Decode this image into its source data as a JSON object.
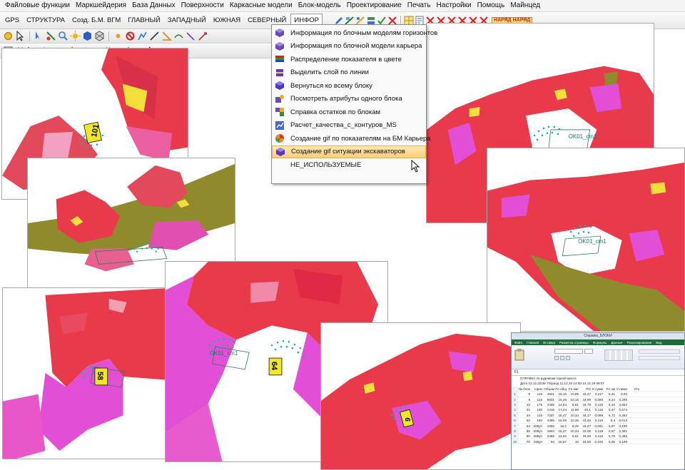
{
  "menubar": {
    "items": [
      {
        "label": "Файловые функции"
      },
      {
        "label": "Маркшейдерия"
      },
      {
        "label": "База Данных"
      },
      {
        "label": "Поверхности"
      },
      {
        "label": "Каркасные модели"
      },
      {
        "label": "Блок-модель"
      },
      {
        "label": "Проектирование"
      },
      {
        "label": "Печать"
      },
      {
        "label": "Настройки"
      },
      {
        "label": "Помощь"
      },
      {
        "label": "Майнцед"
      }
    ]
  },
  "tabs": {
    "items": [
      {
        "label": "GPS"
      },
      {
        "label": "СТРУКТУРА"
      },
      {
        "label": "Созд. Б.М. ВГМ"
      },
      {
        "label": "ГЛАВНЫЙ"
      },
      {
        "label": "ЗАПАДНЫЙ"
      },
      {
        "label": "ЮЖНАЯ"
      },
      {
        "label": "СЕВЕРНЫЙ"
      },
      {
        "label": "ИНФОР",
        "active": true
      }
    ],
    "toolbar_badge": "НАРЯД НАРЯД"
  },
  "dropdown": {
    "items": [
      {
        "label": "Информация по блочным моделям горизонтов",
        "icon": "cube-grid-icon"
      },
      {
        "label": "Информация по блочной модели карьера",
        "icon": "cube-grid-icon"
      },
      {
        "label": "Распределение показателя в цвете",
        "icon": "color-bars-icon"
      },
      {
        "label": "Выделить слой по линии",
        "icon": "layer-select-icon"
      },
      {
        "label": "Вернуться ко всему блоку",
        "icon": "cube-return-icon"
      },
      {
        "label": "Посмотреть атрибуты одного блока",
        "icon": "block-attributes-icon"
      },
      {
        "label": "Справка остатков по блокам",
        "icon": "blocks-report-icon"
      },
      {
        "label": "Расчет_качества_с_контуров_MS",
        "icon": "quality-calc-icon"
      },
      {
        "label": "Создание gif по показателям на БМ Карьера",
        "icon": "gif-indicator-icon"
      },
      {
        "label": "Создание gif ситуации  экскаваторов",
        "icon": "gif-excavator-icon",
        "highlighted": true
      },
      {
        "label": "НЕ_ИСПОЛЬЗУЕМЫЕ",
        "icon": ""
      }
    ]
  },
  "viewports": {
    "v1": {
      "marker": "101"
    },
    "v6": {
      "label": "OK01_cm1"
    },
    "v7": {
      "marker": "58"
    },
    "v8": {
      "label": "OK01_cm1",
      "marker": "64"
    },
    "v9": {
      "marker": "9"
    },
    "v10": {
      "label": "OK01_cm1"
    }
  },
  "spreadsheet": {
    "window_title": "Справка_БЛОКИ",
    "ribbon_tabs": [
      "Файл",
      "Главная",
      "Вставка",
      "Разметка страницы",
      "Формулы",
      "Данные",
      "Рецензирование",
      "Вид"
    ],
    "cell_ref": "F1",
    "header_title": "СПРАВКА по рудникам горной массе",
    "header_period": "Дата 13.12.2016г.   Период 11.12.15 14:00-14.12.19 08:57",
    "columns": [
      "№ блок",
      "гориз",
      "Объем",
      "Fe общ",
      "Fe маг",
      "ПО",
      "S сумм",
      "Fe нм",
      "V немн",
      "Отк"
    ],
    "rows": [
      [
        "1",
        "8",
        "115",
        "4841",
        "16,16",
        "10,95",
        "44,47",
        "0,117",
        "5,41",
        "0,94"
      ],
      [
        "2",
        "9",
        "115",
        "5831",
        "15,26",
        "10,16",
        "44,98",
        "0,086",
        "6,24",
        "0,295"
      ],
      [
        "3",
        "13",
        "175",
        "4498",
        "13,64",
        "8,81",
        "44,79",
        "0,118",
        "6,16",
        "0,652"
      ],
      [
        "4",
        "41",
        "130",
        "1416",
        "17,24",
        "11,86",
        "45,1",
        "0,116",
        "5,47",
        "0,574"
      ],
      [
        "5",
        "44",
        "115",
        "7337",
        "15,47",
        "10,34",
        "44,17",
        "0,069",
        "5,72",
        "0,284"
      ],
      [
        "6",
        "52",
        "160",
        "4369",
        "15,49",
        "10,35",
        "44,45",
        "0,119",
        "5,3",
        "0,614"
      ],
      [
        "7",
        "54",
        "208уп",
        "1866",
        "16,2",
        "9,26",
        "44,27",
        "0,091",
        "5,97",
        "0,180"
      ],
      [
        "8",
        "55",
        "208уп",
        "1803",
        "15,47",
        "10,34",
        "43,05",
        "0,119",
        "5,87",
        "0,381"
      ],
      [
        "9",
        "60",
        "208уп",
        "2486",
        "14,62",
        "9,61",
        "44,28",
        "0,116",
        "5,78",
        "0,482"
      ],
      [
        "10",
        "70",
        "196уп",
        "94",
        "15,97",
        "10",
        "44,66",
        "0,106",
        "6,05",
        "0,185"
      ]
    ]
  },
  "colors": {
    "menubar_bg": "#f3f3f3",
    "highlight": "#f8cf7a",
    "terrain_red": "#e83a4b",
    "terrain_pink": "#e24fd6",
    "terrain_olive": "#8f8a2c",
    "points_cyan": "#18b3a0",
    "marker_yellow": "#f2e62a"
  }
}
